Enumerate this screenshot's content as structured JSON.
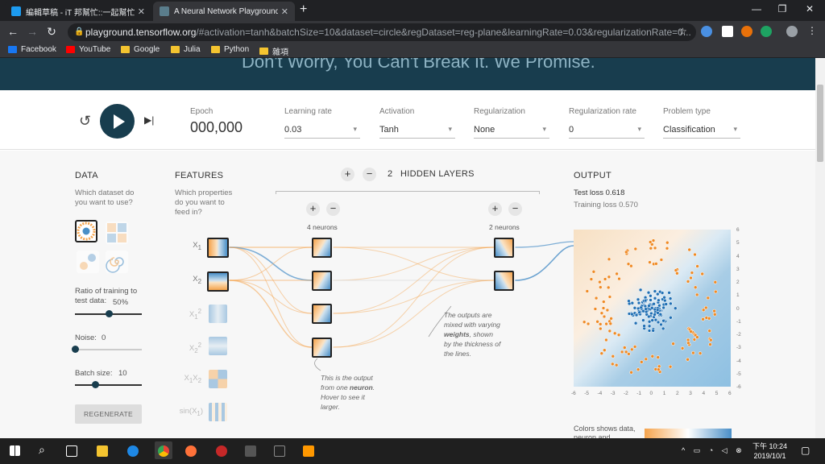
{
  "browser": {
    "tabs": [
      {
        "title": "編輯草稿 - iT 邦幫忙::一起幫忙解",
        "close": "✕"
      },
      {
        "title": "A Neural Network Playground",
        "close": "✕"
      }
    ],
    "new_tab": "+",
    "window": {
      "minimize": "—",
      "restore": "❐",
      "close": "✕"
    },
    "nav": {
      "back": "←",
      "forward": "→",
      "reload": "↻"
    },
    "url_domain": "playground.tensorflow.org",
    "url_rest": "/#activation=tanh&batchSize=10&dataset=circle&regDataset=reg-plane&learningRate=0.03&regularizationRate=0...",
    "bookmarks": [
      "Facebook",
      "YouTube",
      "Google",
      "Julia",
      "Python",
      "雜項"
    ],
    "bookmark_colors": [
      "#1877f2",
      "#ff0000",
      "#f4c430",
      "#f4c430",
      "#f4c430",
      "#f4c430"
    ]
  },
  "hero": {
    "tagline": "Don't Worry, You Can't Break It. We Promise."
  },
  "controls": {
    "epoch_label": "Epoch",
    "epoch_value": "000,000",
    "learning_rate": {
      "label": "Learning rate",
      "value": "0.03"
    },
    "activation": {
      "label": "Activation",
      "value": "Tanh"
    },
    "regularization": {
      "label": "Regularization",
      "value": "None"
    },
    "regularization_rate": {
      "label": "Regularization rate",
      "value": "0"
    },
    "problem_type": {
      "label": "Problem type",
      "value": "Classification"
    }
  },
  "data_panel": {
    "heading": "DATA",
    "question": "Which dataset do you want to use?",
    "ratio_label": "Ratio of training to test data:",
    "ratio_value": "50%",
    "ratio_fraction": 0.5,
    "noise_label": "Noise:",
    "noise_value": "0",
    "noise_fraction": 0.0,
    "batch_label": "Batch size:",
    "batch_value": "10",
    "batch_fraction": 0.3,
    "regenerate": "REGENERATE"
  },
  "features_panel": {
    "heading": "FEATURES",
    "question": "Which properties do you want to feed in?",
    "features": [
      {
        "base": "X",
        "sub": "1",
        "sup": "",
        "active": true
      },
      {
        "base": "X",
        "sub": "2",
        "sup": "",
        "active": true
      },
      {
        "base": "X",
        "sub": "1",
        "sup": "2",
        "active": false
      },
      {
        "base": "X",
        "sub": "2",
        "sup": "2",
        "active": false
      },
      {
        "base": "X",
        "sub": "1",
        "base2": "X",
        "sub2": "2",
        "active": false
      },
      {
        "base": "sin(X",
        "sub": "1",
        "suffix": ")",
        "active": false
      }
    ]
  },
  "network": {
    "hidden_layers_count": "2",
    "hidden_layers_label": "HIDDEN LAYERS",
    "layers": [
      {
        "neurons_label": "4 neurons",
        "count": 4
      },
      {
        "neurons_label": "2 neurons",
        "count": 2
      }
    ],
    "annotation_weights_1": "The outputs are mixed with varying",
    "annotation_weights_bold": "weights",
    "annotation_weights_2": ", shown by the thickness of the lines.",
    "annotation_neuron_1": "This is the output from one",
    "annotation_neuron_bold": "neuron",
    "annotation_neuron_2": ". Hover to see it larger."
  },
  "output_panel": {
    "heading": "OUTPUT",
    "test_loss": "Test loss 0.618",
    "training_loss": "Training loss 0.570",
    "x_ticks": [
      "-6",
      "-5",
      "-4",
      "-3",
      "-2",
      "-1",
      "0",
      "1",
      "2",
      "3",
      "4",
      "5",
      "6"
    ],
    "y_ticks": [
      "6",
      "5",
      "4",
      "3",
      "2",
      "1",
      "0",
      "-1",
      "-2",
      "-3",
      "-4",
      "-5",
      "-6"
    ],
    "legend_text": "Colors shows data, neuron and"
  },
  "taskbar": {
    "clock_line1": "下午 10:24",
    "clock_line2": "2019/10/1"
  }
}
